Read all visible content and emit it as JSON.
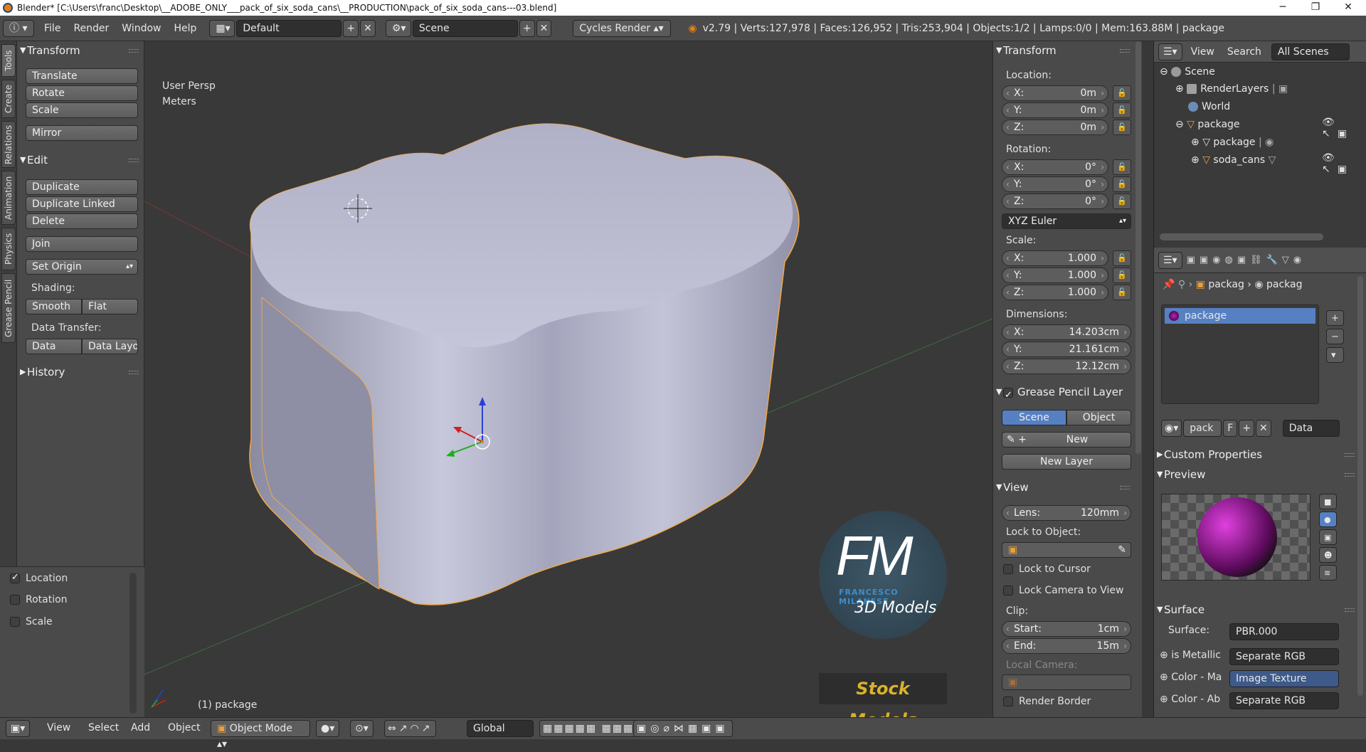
{
  "window": {
    "title": "Blender* [C:\\Users\\franc\\Desktop\\__ADOBE_ONLY___pack_of_six_soda_cans\\__PRODUCTION\\pack_of_six_soda_cans---03.blend]",
    "minimize": "─",
    "maximize": "❐",
    "close": "✕"
  },
  "infobar": {
    "menus": [
      "File",
      "Render",
      "Window",
      "Help"
    ],
    "screen_layout": "Default",
    "scene": "Scene",
    "render_engine": "Cycles Render",
    "stats": "v2.79 | Verts:127,978 | Faces:126,952 | Tris:253,904 | Objects:1/2 | Lamps:0/0 | Mem:163.88M | package"
  },
  "left_tabs": [
    "Tools",
    "Create",
    "Relations",
    "Animation",
    "Physics",
    "Grease Pencil"
  ],
  "toolshelf": {
    "transform_header": "Transform",
    "translate": "Translate",
    "rotate": "Rotate",
    "scale": "Scale",
    "mirror": "Mirror",
    "edit_header": "Edit",
    "duplicate": "Duplicate",
    "duplicate_linked": "Duplicate Linked",
    "delete": "Delete",
    "join": "Join",
    "set_origin": "Set Origin",
    "shading_label": "Shading:",
    "smooth": "Smooth",
    "flat": "Flat",
    "data_transfer_label": "Data Transfer:",
    "data": "Data",
    "data_layout": "Data Layo",
    "history_header": "History"
  },
  "operator": {
    "location": "Location",
    "rotation": "Rotation",
    "scale": "Scale"
  },
  "viewport": {
    "view_name": "User Persp",
    "units": "Meters",
    "object_label": "(1) package",
    "watermark_initials": "FM",
    "watermark_name": "FRANCESCO MILANESE",
    "watermark_sub": "3D Models",
    "watermark_stock": "Stock Models"
  },
  "npanel": {
    "transform_header": "Transform",
    "location_label": "Location:",
    "loc_x": "0m",
    "loc_y": "0m",
    "loc_z": "0m",
    "rotation_label": "Rotation:",
    "rot_x": "0°",
    "rot_y": "0°",
    "rot_z": "0°",
    "rotation_mode": "XYZ Euler",
    "scale_label": "Scale:",
    "scale_x": "1.000",
    "scale_y": "1.000",
    "scale_z": "1.000",
    "dimensions_label": "Dimensions:",
    "dim_x": "14.203cm",
    "dim_y": "21.161cm",
    "dim_z": "12.12cm",
    "axis_x": "X:",
    "axis_y": "Y:",
    "axis_z": "Z:",
    "grease_header": "Grease Pencil Layer",
    "gp_scene": "Scene",
    "gp_object": "Object",
    "gp_new": "New",
    "gp_new_layer": "New Layer",
    "view_header": "View",
    "lens_label": "Lens:",
    "lens_value": "120mm",
    "lock_to_object": "Lock to Object:",
    "lock_to_cursor": "Lock to Cursor",
    "lock_camera": "Lock Camera to View",
    "clip_label": "Clip:",
    "clip_start_label": "Start:",
    "clip_start": "1cm",
    "clip_end_label": "End:",
    "clip_end": "15m",
    "local_camera": "Local Camera:",
    "render_border": "Render Border"
  },
  "outliner": {
    "view": "View",
    "search": "Search",
    "all_scenes": "All Scenes",
    "items": [
      "Scene",
      "RenderLayers",
      "World",
      "package",
      "package",
      "soda_cans"
    ]
  },
  "properties": {
    "breadcrumb_1": "packag",
    "breadcrumb_2": "packag",
    "material_slot": "package",
    "mat_name": "pack",
    "fake_user": "F",
    "link": "Data",
    "custom_props": "Custom Properties",
    "preview": "Preview",
    "surface_header": "Surface",
    "surface_label": "Surface:",
    "surface_value": "PBR.000",
    "rows": [
      {
        "label": "is Metallic",
        "value": "Separate RGB"
      },
      {
        "label": "Color - Ma",
        "value": "Image Texture"
      },
      {
        "label": "Color - Ab",
        "value": "Separate RGB"
      }
    ]
  },
  "bottombar": {
    "view": "View",
    "select": "Select",
    "add": "Add",
    "object": "Object",
    "mode": "Object Mode",
    "orientation": "Global"
  },
  "colors": {
    "selected_blue": "#5680c2",
    "outline_orange": "#f0a94a",
    "watermark_blue": "#3a8fd0",
    "stock_gold": "#d8b22c"
  }
}
